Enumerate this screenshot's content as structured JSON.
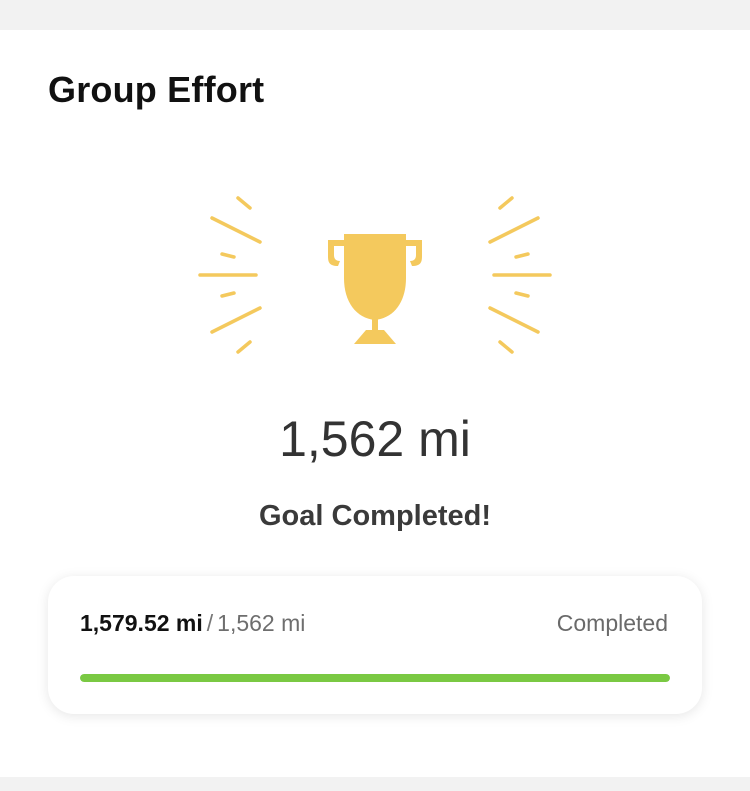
{
  "card": {
    "title": "Group Effort"
  },
  "goal": {
    "value": "1,562 mi",
    "status": "Goal Completed!"
  },
  "progress": {
    "current": "1,579.52 mi",
    "separator": "/",
    "target": "1,562 mi",
    "status_label": "Completed",
    "fraction": 1.0,
    "bar_color": "#7ac943"
  },
  "colors": {
    "trophy": "#f4c95d",
    "background": "#f2f2f2"
  },
  "icons": {
    "trophy": "trophy-icon",
    "burst": "burst-rays"
  }
}
